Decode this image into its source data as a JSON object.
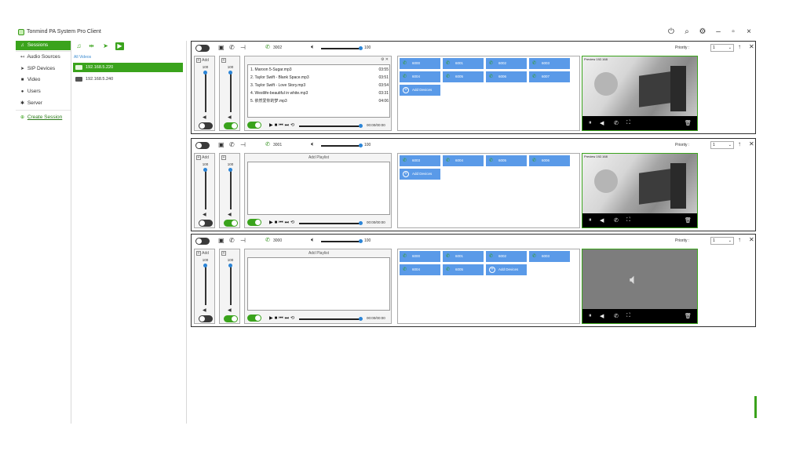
{
  "window": {
    "title": "Tonmind PA System Pro Client",
    "controls": [
      "power-icon",
      "search-icon",
      "gear-icon",
      "minimize-icon",
      "restore-icon",
      "close-icon"
    ]
  },
  "nav": {
    "items": [
      {
        "label": "Sessions",
        "icon": "music-note-icon",
        "active": true
      },
      {
        "label": "Audio Sources",
        "icon": "audio-source-icon"
      },
      {
        "label": "SIP Devices",
        "icon": "send-icon"
      },
      {
        "label": "Video",
        "icon": "video-camera-icon"
      },
      {
        "label": "Users",
        "icon": "user-icon"
      },
      {
        "label": "Server",
        "icon": "gear-icon"
      }
    ],
    "create_session": "Create Session"
  },
  "subpanel": {
    "header": "All Videos",
    "cameras": [
      "192.168.5.220",
      "192.168.5.240"
    ],
    "selected": "192.168.5.220"
  },
  "sessions": [
    {
      "extension": "3002",
      "volume": "100",
      "priority_label": "Priority :",
      "priority": "1",
      "col1": {
        "add": "Add",
        "value": "100"
      },
      "col2": {
        "value": "100"
      },
      "playlist_header": "",
      "tracks": [
        {
          "title": "1. Maroon 5-Sugar.mp3",
          "duration": "03:55"
        },
        {
          "title": "2. Taylor Swift - Blank Space.mp3",
          "duration": "03:51"
        },
        {
          "title": "3. Taylor Swift - Love Story.mp3",
          "duration": "03:54"
        },
        {
          "title": "4. Westlife-beautiful in white.mp3",
          "duration": "03:31"
        },
        {
          "title": "5. 依然爱你的梦.mp3",
          "duration": "04:06"
        }
      ],
      "time": "00:00/00:00",
      "devices": [
        "6000",
        "6001",
        "6002",
        "6003",
        "6004",
        "6005",
        "6006",
        "6007"
      ],
      "add_devices": "Add Devices",
      "video_label": "Preview 192.168",
      "has_video": true
    },
    {
      "extension": "3001",
      "volume": "100",
      "priority_label": "Priority :",
      "priority": "1",
      "col1": {
        "add": "Add",
        "value": "100"
      },
      "col2": {
        "value": "100"
      },
      "playlist_header": "Add Playlist",
      "tracks": [],
      "time": "00:00/00:00",
      "devices": [
        "6003",
        "6004",
        "6005",
        "6006"
      ],
      "add_devices": "Add Devices",
      "video_label": "Preview 192.168",
      "has_video": true
    },
    {
      "extension": "3000",
      "volume": "100",
      "priority_label": "Priority :",
      "priority": "1",
      "col1": {
        "add": "Add",
        "value": "100"
      },
      "col2": {
        "value": "100"
      },
      "playlist_header": "Add Playlist",
      "tracks": [],
      "time": "00:00/00:00",
      "devices": [
        "6000",
        "6001",
        "6002",
        "6003",
        "6004",
        "6005"
      ],
      "add_devices": "Add Devices",
      "video_label": "",
      "has_video": false
    }
  ],
  "colors": {
    "accent": "#3aa31c",
    "device_tile": "#5a9ae8",
    "slider_knob": "#2b84d6"
  }
}
